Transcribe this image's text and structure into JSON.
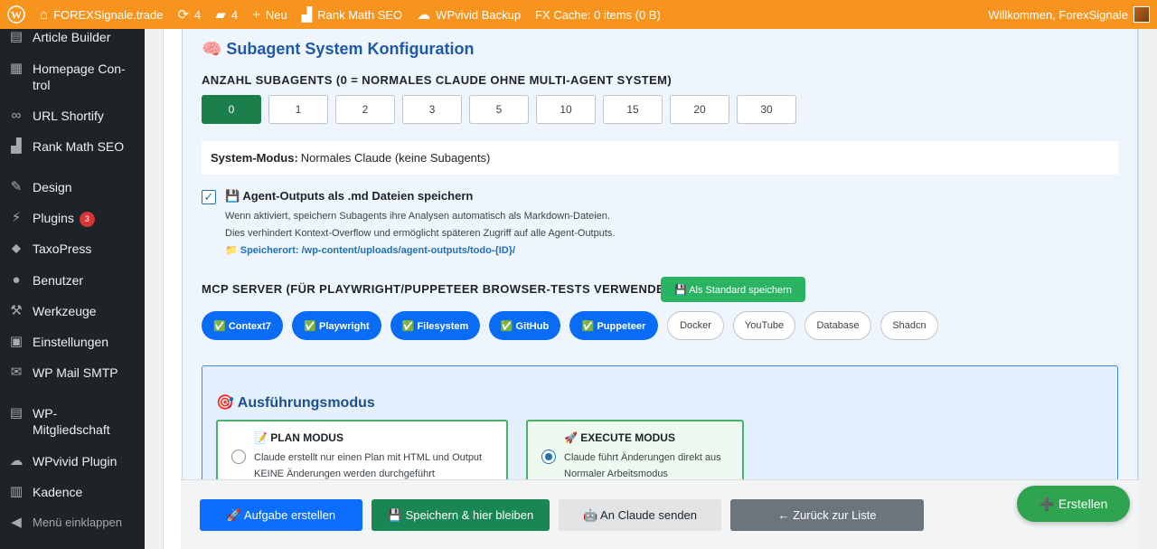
{
  "adminbar": {
    "site_name": "FOREXSignale.trade",
    "updates_count": "4",
    "comments_count": "4",
    "new_label": "Neu",
    "rankmath_label": "Rank Math SEO",
    "wpvivid_label": "WPvivid Backup",
    "fx_cache_label": "FX Cache: 0 items (0 B)",
    "greeting": "Willkommen, ForexSignale"
  },
  "sidebar": {
    "items": [
      {
        "label": "Article Builder",
        "icon": "builder-icon"
      },
      {
        "label": "Homepage Con-trol",
        "icon": "homepage-icon"
      },
      {
        "label": "URL Shortify",
        "icon": "link-icon"
      },
      {
        "label": "Rank Math SEO",
        "icon": "rankmath-icon"
      },
      {
        "label": "Design",
        "icon": "brush-icon"
      },
      {
        "label": "Plugins",
        "icon": "plugin-icon",
        "badge": "3"
      },
      {
        "label": "TaxoPress",
        "icon": "tag-icon"
      },
      {
        "label": "Benutzer",
        "icon": "user-icon"
      },
      {
        "label": "Werkzeuge",
        "icon": "wrench-icon"
      },
      {
        "label": "Einstellungen",
        "icon": "settings-icon"
      },
      {
        "label": "WP Mail SMTP",
        "icon": "mail-icon"
      },
      {
        "label": "WP-Mitgliedschaft",
        "icon": "membership-icon"
      },
      {
        "label": "WPvivid Plugin",
        "icon": "cloud-icon"
      },
      {
        "label": "Kadence",
        "icon": "kadence-icon"
      }
    ],
    "collapse_label": "Menü einklappen"
  },
  "subagent": {
    "title": "Subagent System Konfiguration",
    "count_label": "ANZAHL SUBAGENTS (0 = NORMALES CLAUDE OHNE MULTI-AGENT SYSTEM)",
    "counts": [
      "0",
      "1",
      "2",
      "3",
      "5",
      "10",
      "15",
      "20",
      "30"
    ],
    "selected_count": "0",
    "mode_label": "System-Modus:",
    "mode_value": "Normales Claude (keine Subagents)",
    "save_outputs_label": "Agent-Outputs als .md Dateien speichern",
    "save_outputs_checked": true,
    "help_line1": "Wenn aktiviert, speichern Subagents ihre Analysen automatisch als Markdown-Dateien.",
    "help_line2": "Dies verhindert Kontext-Overflow und ermöglicht späteren Zugriff auf alle Agent-Outputs.",
    "help_line3": "📁 Speicherort: /wp-content/uploads/agent-outputs/todo-{ID}/"
  },
  "mcp": {
    "label": "MCP SERVER (FÜR PLAYWRIGHT/PUPPETEER BROWSER-TESTS VERWENDEN)",
    "save_default_label": "💾 Als Standard speichern",
    "servers": [
      {
        "label": "✅ Context7",
        "active": true
      },
      {
        "label": "✅ Playwright",
        "active": true
      },
      {
        "label": "✅ Filesystem",
        "active": true
      },
      {
        "label": "✅ GitHub",
        "active": true
      },
      {
        "label": "✅ Puppeteer",
        "active": true
      },
      {
        "label": "Docker",
        "active": false
      },
      {
        "label": "YouTube",
        "active": false
      },
      {
        "label": "Database",
        "active": false
      },
      {
        "label": "Shadcn",
        "active": false
      }
    ]
  },
  "execution": {
    "title": "🎯 Ausführungsmodus",
    "plan": {
      "title": "📝 PLAN MODUS",
      "line1": "Claude erstellt nur einen Plan mit HTML und Output",
      "line2": "KEINE Änderungen werden durchgeführt",
      "selected": false
    },
    "execute": {
      "title": "🚀 EXECUTE MODUS",
      "line1": "Claude führt Änderungen direkt aus",
      "line2": "Normaler Arbeitsmodus",
      "selected": true
    }
  },
  "footer": {
    "create_task": "🚀 Aufgabe erstellen",
    "save_stay": "💾 Speichern & hier bleiben",
    "send_claude": "🤖 An Claude senden",
    "back_list": "← Zurück zur Liste"
  },
  "fab_label": "➕ Erstellen",
  "colors": {
    "adminbar": "#f7941e",
    "sidebar": "#1d2327",
    "active_green": "#1a7f4b",
    "pill_blue": "#0a6cf5"
  }
}
